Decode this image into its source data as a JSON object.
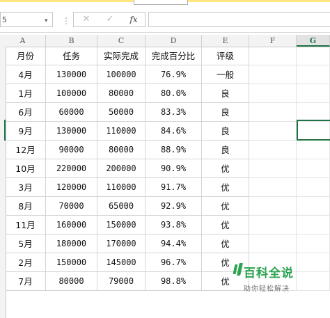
{
  "formula_bar": {
    "name_box_value": "5",
    "separator_glyph": "⋮",
    "cancel_glyph": "✕",
    "enter_glyph": "✓",
    "fx_label": "fx",
    "formula_value": ""
  },
  "columns": [
    "A",
    "B",
    "C",
    "D",
    "E",
    "F",
    "G"
  ],
  "selected_column": "G",
  "table": {
    "headers": [
      "月份",
      "任务",
      "实际完成",
      "完成百分比",
      "评级"
    ],
    "rows": [
      [
        "4月",
        "130000",
        "100000",
        "76.9%",
        "一般"
      ],
      [
        "1月",
        "100000",
        "80000",
        "80.0%",
        "良"
      ],
      [
        "6月",
        "60000",
        "50000",
        "83.3%",
        "良"
      ],
      [
        "9月",
        "130000",
        "110000",
        "84.6%",
        "良"
      ],
      [
        "12月",
        "90000",
        "80000",
        "88.9%",
        "良"
      ],
      [
        "10月",
        "220000",
        "200000",
        "90.9%",
        "优"
      ],
      [
        "3月",
        "120000",
        "110000",
        "91.7%",
        "优"
      ],
      [
        "8月",
        "70000",
        "65000",
        "92.9%",
        "优"
      ],
      [
        "11月",
        "160000",
        "150000",
        "93.8%",
        "优"
      ],
      [
        "5月",
        "180000",
        "170000",
        "94.4%",
        "优"
      ],
      [
        "2月",
        "150000",
        "145000",
        "96.7%",
        "优"
      ],
      [
        "7月",
        "80000",
        "79000",
        "98.8%",
        "优"
      ]
    ]
  },
  "watermark": {
    "title": "百科全说",
    "subtitle": "助你轻松解决"
  },
  "colors": {
    "accent": "#217346",
    "watermark_green": "#2aa44f"
  }
}
